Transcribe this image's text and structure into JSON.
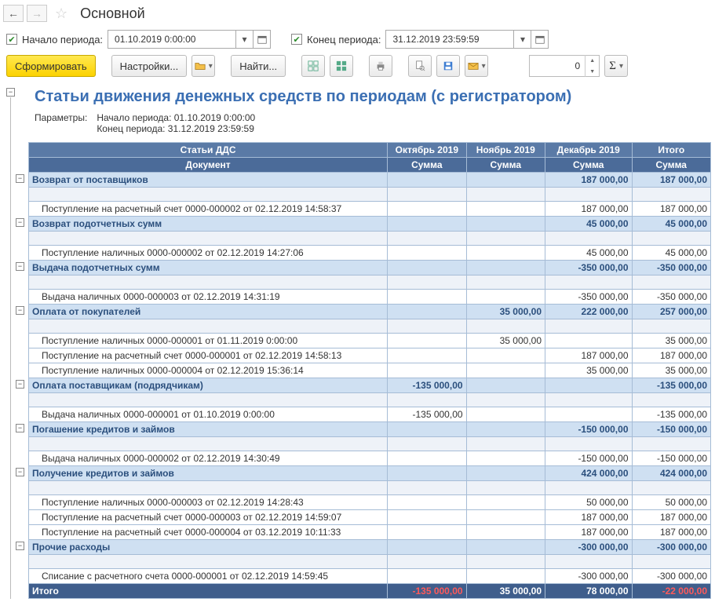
{
  "nav": {
    "back": "←",
    "forward": "→",
    "star": "☆"
  },
  "page_title": "Основной",
  "period": {
    "start_chk": "✔",
    "start_label": "Начало периода:",
    "start_value": "01.10.2019  0:00:00",
    "end_chk": "✔",
    "end_label": "Конец периода:",
    "end_value": "31.12.2019 23:59:59"
  },
  "toolbar": {
    "generate": "Сформировать",
    "settings": "Настройки...",
    "find": "Найти...",
    "zero": "0"
  },
  "report": {
    "title": "Статьи движения денежных средств по периодам (с регистратором)",
    "params_label": "Параметры:",
    "params_line1": "Начало периода: 01.10.2019 0:00:00",
    "params_line2": "Конец периода: 31.12.2019 23:59:59",
    "col_group_label": "Статьи ДДС",
    "col_doc": "Документ",
    "periods": [
      "Октябрь 2019",
      "Ноябрь 2019",
      "Декабрь 2019",
      "Итого"
    ],
    "sum_label": "Сумма",
    "sections": [
      {
        "title": "Возврат от поставщиков",
        "totals": [
          "",
          "",
          "187 000,00",
          "187 000,00"
        ],
        "rows": [
          {
            "doc": "Поступление на расчетный счет 0000-000002 от 02.12.2019 14:58:37",
            "vals": [
              "",
              "",
              "187 000,00",
              "187 000,00"
            ]
          }
        ]
      },
      {
        "title": "Возврат подотчетных сумм",
        "totals": [
          "",
          "",
          "45 000,00",
          "45 000,00"
        ],
        "rows": [
          {
            "doc": "Поступление наличных 0000-000002 от 02.12.2019 14:27:06",
            "vals": [
              "",
              "",
              "45 000,00",
              "45 000,00"
            ]
          }
        ]
      },
      {
        "title": "Выдача подотчетных сумм",
        "totals": [
          "",
          "",
          "-350 000,00",
          "-350 000,00"
        ],
        "rows": [
          {
            "doc": "Выдача наличных 0000-000003 от 02.12.2019 14:31:19",
            "vals": [
              "",
              "",
              "-350 000,00",
              "-350 000,00"
            ]
          }
        ]
      },
      {
        "title": "Оплата от покупателей",
        "totals": [
          "",
          "35 000,00",
          "222 000,00",
          "257 000,00"
        ],
        "rows": [
          {
            "doc": "Поступление наличных 0000-000001 от 01.11.2019 0:00:00",
            "vals": [
              "",
              "35 000,00",
              "",
              "35 000,00"
            ]
          },
          {
            "doc": "Поступление на расчетный счет 0000-000001 от 02.12.2019 14:58:13",
            "vals": [
              "",
              "",
              "187 000,00",
              "187 000,00"
            ]
          },
          {
            "doc": "Поступление наличных 0000-000004 от 02.12.2019 15:36:14",
            "vals": [
              "",
              "",
              "35 000,00",
              "35 000,00"
            ]
          }
        ]
      },
      {
        "title": "Оплата поставщикам (подрядчикам)",
        "totals": [
          "-135 000,00",
          "",
          "",
          "-135 000,00"
        ],
        "rows": [
          {
            "doc": "Выдача наличных 0000-000001 от 01.10.2019 0:00:00",
            "vals": [
              "-135 000,00",
              "",
              "",
              "-135 000,00"
            ]
          }
        ]
      },
      {
        "title": "Погашение кредитов и займов",
        "totals": [
          "",
          "",
          "-150 000,00",
          "-150 000,00"
        ],
        "rows": [
          {
            "doc": "Выдача наличных 0000-000002 от 02.12.2019 14:30:49",
            "vals": [
              "",
              "",
              "-150 000,00",
              "-150 000,00"
            ]
          }
        ]
      },
      {
        "title": "Получение кредитов и займов",
        "totals": [
          "",
          "",
          "424 000,00",
          "424 000,00"
        ],
        "rows": [
          {
            "doc": "Поступление наличных 0000-000003 от 02.12.2019 14:28:43",
            "vals": [
              "",
              "",
              "50 000,00",
              "50 000,00"
            ]
          },
          {
            "doc": "Поступление на расчетный счет 0000-000003 от 02.12.2019 14:59:07",
            "vals": [
              "",
              "",
              "187 000,00",
              "187 000,00"
            ]
          },
          {
            "doc": "Поступление на расчетный счет 0000-000004 от 03.12.2019 10:11:33",
            "vals": [
              "",
              "",
              "187 000,00",
              "187 000,00"
            ]
          }
        ]
      },
      {
        "title": "Прочие расходы",
        "totals": [
          "",
          "",
          "-300 000,00",
          "-300 000,00"
        ],
        "rows": [
          {
            "doc": "Списание с расчетного счета 0000-000001 от 02.12.2019 14:59:45",
            "vals": [
              "",
              "",
              "-300 000,00",
              "-300 000,00"
            ]
          }
        ]
      }
    ],
    "grand_total_label": "Итого",
    "grand_total": [
      "-135 000,00",
      "35 000,00",
      "78 000,00",
      "-22 000,00"
    ]
  }
}
